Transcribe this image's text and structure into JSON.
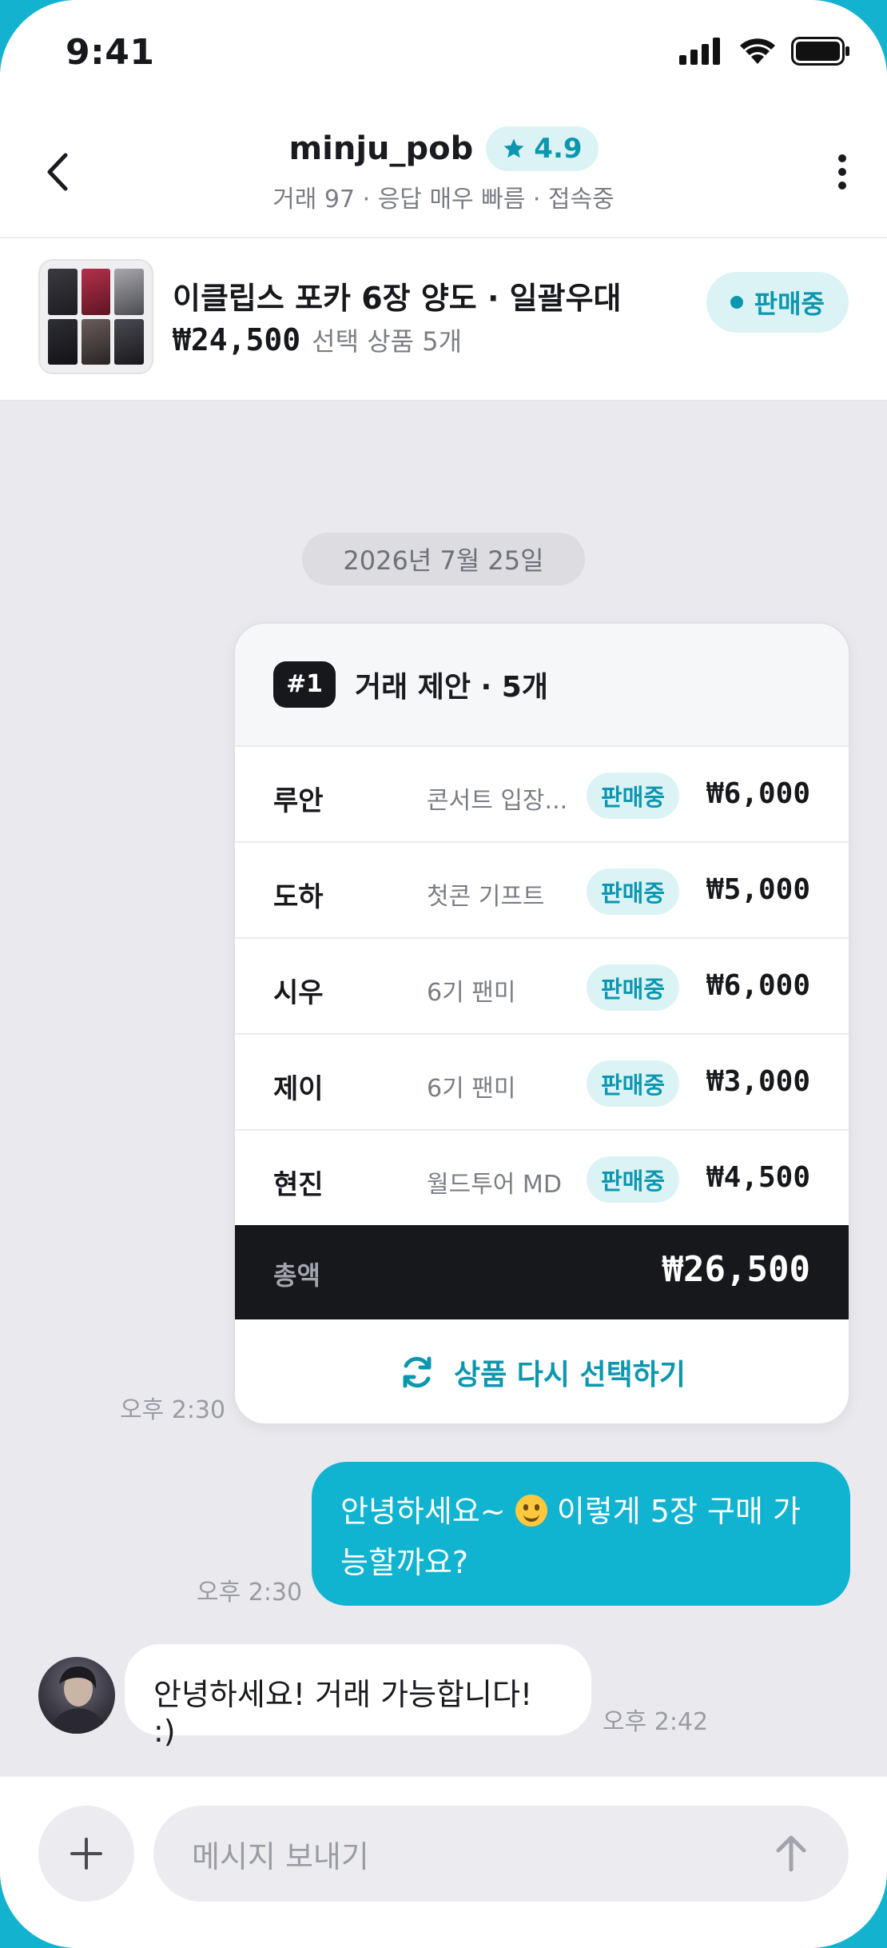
{
  "status": {
    "time": "9:41"
  },
  "header": {
    "name": "minju_pob",
    "rating": "4.9",
    "subtitle": "거래 97 · 응답 매우 빠름 · 접속중"
  },
  "product": {
    "title": "이클립스 포카 6장 양도 · 일괄우대",
    "price": "₩24,500",
    "selected": "선택 상품 5개",
    "status": "판매중"
  },
  "chat": {
    "date": "2026년 7월 25일",
    "offer": {
      "number": "#1",
      "title": "거래 제안 · 5개",
      "items": [
        {
          "name": "루안",
          "desc": "콘서트 입장...",
          "status": "판매중",
          "price": "₩6,000"
        },
        {
          "name": "도하",
          "desc": "첫콘 기프트",
          "status": "판매중",
          "price": "₩5,000"
        },
        {
          "name": "시우",
          "desc": "6기 팬미",
          "status": "판매중",
          "price": "₩6,000"
        },
        {
          "name": "제이",
          "desc": "6기 팬미",
          "status": "판매중",
          "price": "₩3,000"
        },
        {
          "name": "현진",
          "desc": "월드투어 MD",
          "status": "판매중",
          "price": "₩4,500"
        }
      ],
      "total_label": "총액",
      "total": "₩26,500",
      "reselect": "상품 다시 선택하기",
      "time": "오후 2:30"
    },
    "outgoing": {
      "text_a": "안녕하세요~ ",
      "text_b": " 이렇게 5장 구매 가능할까요?",
      "time": "오후 2:30"
    },
    "incoming": {
      "text": "안녕하세요! 거래 가능합니다! :)",
      "time": "오후 2:42"
    }
  },
  "input": {
    "placeholder": "메시지 보내기"
  },
  "colors": {
    "accent": "#10b3d0",
    "accent_text": "#0c97ae",
    "dark": "#17181c"
  }
}
